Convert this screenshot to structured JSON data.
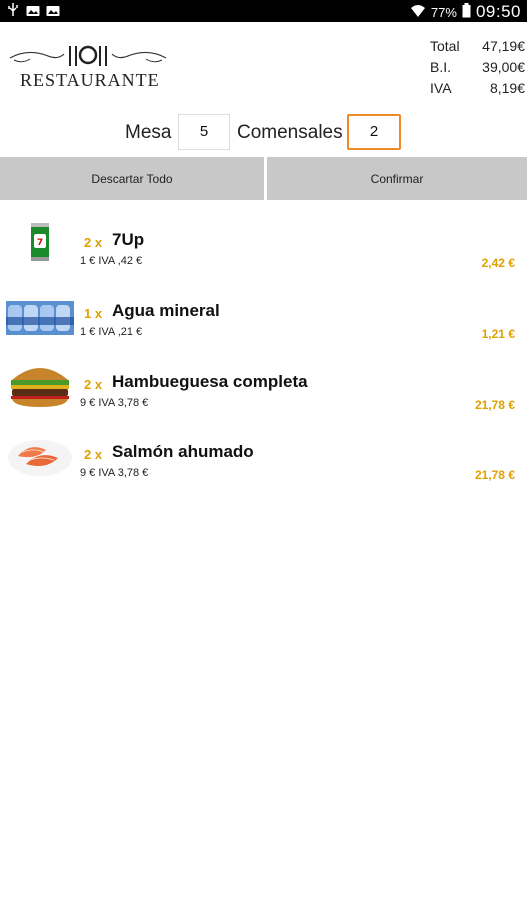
{
  "status_bar": {
    "battery": "77%",
    "time": "09:50"
  },
  "header": {
    "logo_text": "RESTAURANTE",
    "totals": [
      {
        "label": "Total",
        "value": "47,19€"
      },
      {
        "label": "B.I.",
        "value": "39,00€"
      },
      {
        "label": "IVA",
        "value": "8,19€"
      }
    ]
  },
  "table": {
    "mesa_label": "Mesa",
    "mesa_value": "5",
    "comensales_label": "Comensales",
    "comensales_value": "2"
  },
  "actions": {
    "discard_label": "Descartar Todo",
    "confirm_label": "Confirmar"
  },
  "items": [
    {
      "qty": "2 x",
      "name": "7Up",
      "detail": "1 € IVA ,42 €",
      "price": "2,42 €",
      "icon": "soda-can-icon"
    },
    {
      "qty": "1 x",
      "name": "Agua mineral",
      "detail": "1 € IVA ,21 €",
      "price": "1,21 €",
      "icon": "water-bottles-icon"
    },
    {
      "qty": "2 x",
      "name": "Hambueguesa completa",
      "detail": "9 € IVA 3,78 €",
      "price": "21,78 €",
      "icon": "burger-icon"
    },
    {
      "qty": "2 x",
      "name": "Salmón ahumado",
      "detail": "9 € IVA 3,78 €",
      "price": "21,78 €",
      "icon": "salmon-icon"
    }
  ],
  "colors": {
    "accent": "#f08a24",
    "price": "#e0a000",
    "button_bg": "#c8c8c8"
  }
}
